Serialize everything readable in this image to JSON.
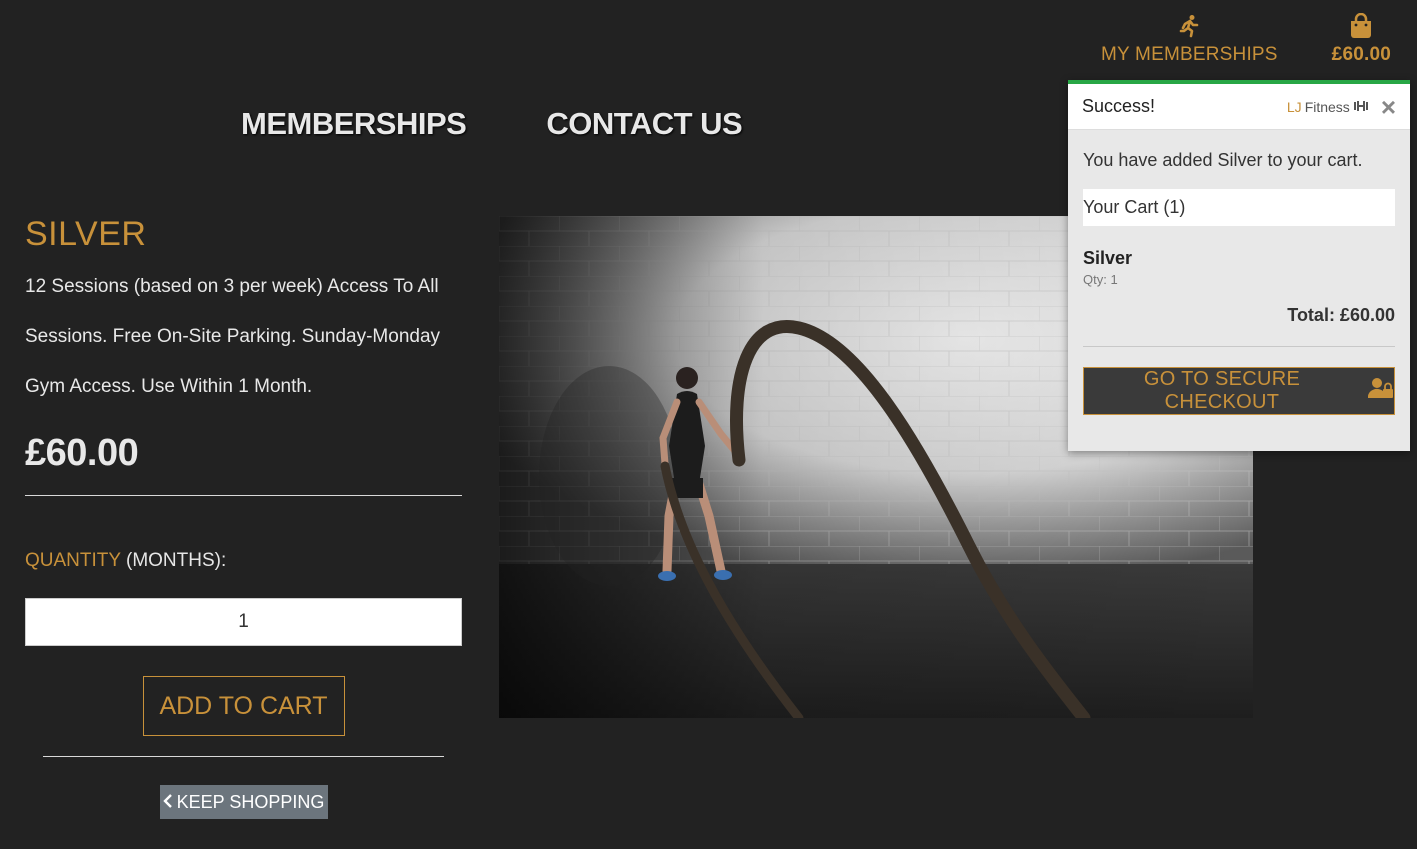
{
  "top_nav": {
    "memberships_label": "MY MEMBERSHIPS",
    "memberships_icon": "running-person-icon",
    "cart_total": "£60.00",
    "cart_icon": "shopping-bag-icon"
  },
  "main_nav": {
    "items": [
      {
        "label": "MEMBERSHIPS"
      },
      {
        "label": "CONTACT US"
      }
    ]
  },
  "product": {
    "title": "SILVER",
    "description": "12 Sessions (based on 3 per week) Access To All Sessions. Free On-Site Parking. Sunday-Monday Gym Access. Use Within 1 Month.",
    "price": "£60.00",
    "quantity_label": "QUANTITY",
    "quantity_suffix": "(MONTHS):",
    "quantity_value": "1",
    "add_to_cart_label": "ADD TO CART",
    "keep_shopping_label": "KEEP SHOPPING"
  },
  "toast": {
    "title": "Success!",
    "brand_prefix": "LJ",
    "brand_name": "Fitness",
    "message": "You have added Silver to your cart.",
    "cart_label": "Your Cart (1)",
    "item_name": "Silver",
    "item_qty": "Qty: 1",
    "total": "Total: £60.00",
    "checkout_label": "GO TO SECURE CHECKOUT"
  },
  "colors": {
    "accent": "#c8913a",
    "background": "#222222",
    "success": "#28a745"
  }
}
